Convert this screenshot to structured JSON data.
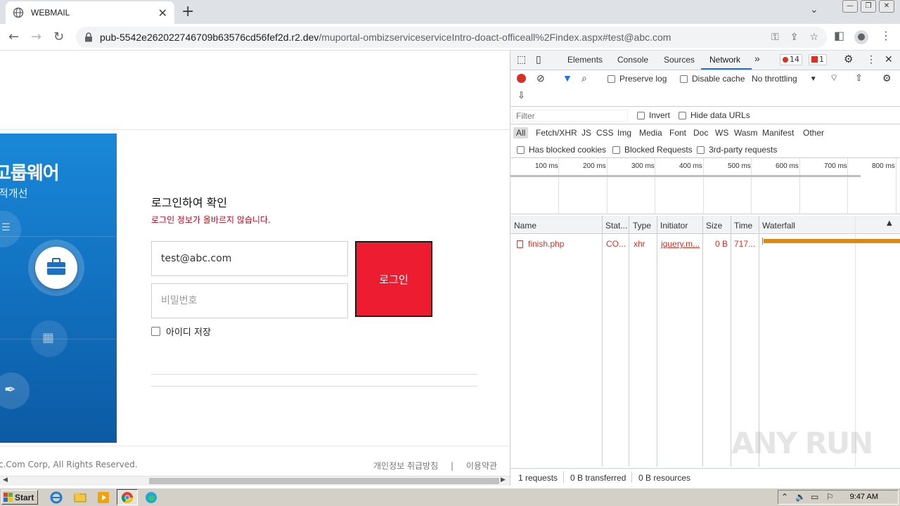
{
  "browser": {
    "tab_title": "WEBMAIL",
    "url_host": "pub-5542e262022746709b63576cd56fef2d.r2.dev",
    "url_path": "/muportal-ombizserviceserviceIntro-doact-officeall%2Findex.aspx#test@abc.com"
  },
  "page": {
    "banner_title": "고룹웨어",
    "banner_subtitle": "적개선",
    "login_title": "로그인하여 확인",
    "login_error": "로그인 정보가 올바르지 않습니다.",
    "email_value": "test@abc.com",
    "password_placeholder": "비밀번호",
    "login_button": "로그인",
    "remember_label": "아이디 저장",
    "copyright": "c.Com Corp, All Rights Reserved.",
    "footer_privacy": "개인정보 취급방침",
    "footer_sep": "|",
    "footer_terms": "이용약관"
  },
  "devtools": {
    "tabs": [
      "Elements",
      "Console",
      "Sources",
      "Network"
    ],
    "more_tabs": "»",
    "error_count": "14",
    "issue_count": "1",
    "preserve_log": "Preserve log",
    "disable_cache": "Disable cache",
    "throttling": "No throttling",
    "filter_placeholder": "Filter",
    "invert": "Invert",
    "hide_data_urls": "Hide data URLs",
    "type_filters": [
      "All",
      "Fetch/XHR",
      "JS",
      "CSS",
      "Img",
      "Media",
      "Font",
      "Doc",
      "WS",
      "Wasm",
      "Manifest",
      "Other"
    ],
    "has_blocked_cookies": "Has blocked cookies",
    "blocked_requests": "Blocked Requests",
    "third_party": "3rd-party requests",
    "timeline_labels": [
      "100 ms",
      "200 ms",
      "300 ms",
      "400 ms",
      "500 ms",
      "600 ms",
      "700 ms",
      "800 ms"
    ],
    "columns": {
      "name": "Name",
      "status": "Stat...",
      "type": "Type",
      "initiator": "Initiator",
      "size": "Size",
      "time": "Time",
      "waterfall": "Waterfall"
    },
    "request": {
      "name": "finish.php",
      "status": "CO...",
      "type": "xhr",
      "initiator": "jquery.m...",
      "size": "0 B",
      "time": "717..."
    },
    "status": {
      "requests": "1 requests",
      "transferred": "0 B transferred",
      "resources": "0 B resources"
    }
  },
  "watermark": "ANY RUN",
  "taskbar": {
    "start": "Start",
    "clock": "9:47 AM"
  }
}
